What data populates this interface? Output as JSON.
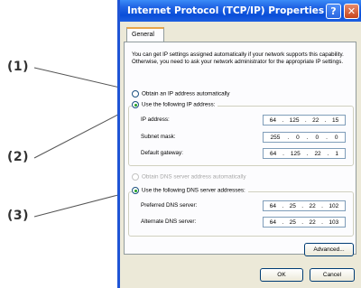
{
  "callouts": {
    "c1": "(1)",
    "c2": "(2)",
    "c3": "(3)"
  },
  "window": {
    "title": "Internet Protocol (TCP/IP) Properties",
    "help_glyph": "?",
    "close_glyph": "✕"
  },
  "tabs": {
    "general": "General"
  },
  "description": "You can get IP settings assigned automatically if your network supports this capability. Otherwise, you need to ask your network administrator for the appropriate IP settings.",
  "ip_options": {
    "auto": "Obtain an IP address automatically",
    "manual": "Use the following IP address:",
    "selected": "manual"
  },
  "ip_fields": [
    {
      "label": "IP address:",
      "octets": [
        "64",
        "125",
        "22",
        "15"
      ]
    },
    {
      "label": "Subnet mask:",
      "octets": [
        "255",
        "0",
        "0",
        "0"
      ]
    },
    {
      "label": "Default gateway:",
      "octets": [
        "64",
        "125",
        "22",
        "1"
      ]
    }
  ],
  "dns_options": {
    "auto": "Obtain DNS server address automatically",
    "manual": "Use the following DNS server addresses:",
    "selected": "manual"
  },
  "dns_fields": [
    {
      "label": "Preferred DNS server:",
      "octets": [
        "64",
        "25",
        "22",
        "102"
      ]
    },
    {
      "label": "Alternate DNS server:",
      "octets": [
        "64",
        "25",
        "22",
        "103"
      ]
    }
  ],
  "buttons": {
    "advanced": "Advanced...",
    "ok": "OK",
    "cancel": "Cancel"
  },
  "colors": {
    "titlebar": "#0a4ed8",
    "window_bg": "#ece9d8",
    "radio_dot": "#21a121"
  }
}
